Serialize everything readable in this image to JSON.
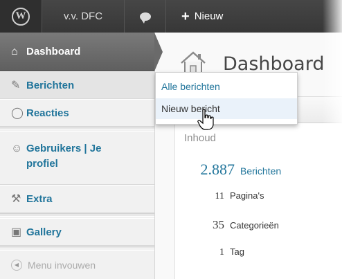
{
  "adminbar": {
    "site_name": "v.v. DFC",
    "new_label": "Nieuw",
    "icons": {
      "logo": "wordpress-logo-icon",
      "comments": "speech-bubble-icon",
      "new": "plus-icon"
    }
  },
  "sidebar": {
    "items": [
      {
        "label": "Dashboard",
        "icon": "house-icon"
      },
      {
        "label": "Berichten",
        "icon": "pushpin-icon"
      },
      {
        "label": "Reacties",
        "icon": "speech-bubble-icon"
      },
      {
        "label": "Gebruikers | Je profiel",
        "icon": "users-icon"
      },
      {
        "label": "Extra",
        "icon": "tools-icon"
      },
      {
        "label": "Gallery",
        "icon": "gallery-icon"
      }
    ],
    "collapse_label": "Menu invouwen"
  },
  "flyout": {
    "items": [
      {
        "label": "Alle berichten"
      },
      {
        "label": "Nieuw bericht"
      }
    ]
  },
  "main": {
    "title": "Dashboard",
    "section_label": "Inhoud",
    "counts": [
      {
        "number": "2.887",
        "label": "Berichten"
      },
      {
        "number": "11",
        "label": "Pagina's"
      },
      {
        "number": "35",
        "label": "Categorieën"
      },
      {
        "number": "1",
        "label": "Tag"
      }
    ]
  },
  "colors": {
    "link": "#21759b",
    "adminbar_bg": "#464646",
    "active_menu_bg": "#6a6a6a"
  }
}
